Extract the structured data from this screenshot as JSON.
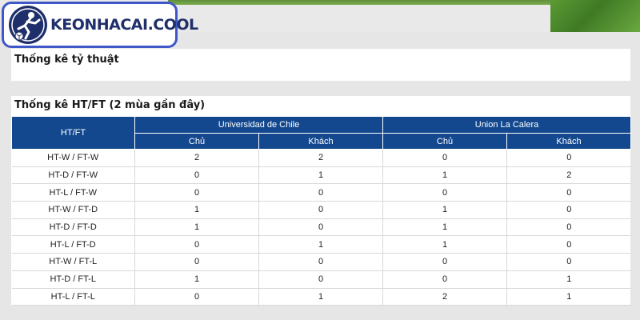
{
  "brand": {
    "name": "KEONHACAI.COOL"
  },
  "odds_panel": {
    "title": "Thống kê tỷ thuật"
  },
  "htft_panel": {
    "title": "Thống kê HT/FT (2 mùa gần đây)",
    "row_header": "HT/FT",
    "teams": [
      "Universidad de Chile",
      "Union La Calera"
    ],
    "sub_headers": [
      "Chủ",
      "Khách",
      "Chủ",
      "Khách"
    ],
    "rows": [
      {
        "label": "HT-W / FT-W",
        "values": [
          "2",
          "2",
          "0",
          "0"
        ]
      },
      {
        "label": "HT-D / FT-W",
        "values": [
          "0",
          "1",
          "1",
          "2"
        ]
      },
      {
        "label": "HT-L / FT-W",
        "values": [
          "0",
          "0",
          "0",
          "0"
        ]
      },
      {
        "label": "HT-W / FT-D",
        "values": [
          "1",
          "0",
          "1",
          "0"
        ]
      },
      {
        "label": "HT-D / FT-D",
        "values": [
          "1",
          "0",
          "1",
          "0"
        ]
      },
      {
        "label": "HT-L / FT-D",
        "values": [
          "0",
          "1",
          "1",
          "0"
        ]
      },
      {
        "label": "HT-W / FT-L",
        "values": [
          "0",
          "0",
          "0",
          "0"
        ]
      },
      {
        "label": "HT-D / FT-L",
        "values": [
          "1",
          "0",
          "0",
          "1"
        ]
      },
      {
        "label": "HT-L / FT-L",
        "values": [
          "0",
          "1",
          "2",
          "1"
        ]
      }
    ]
  },
  "colors": {
    "header_blue": "#13488f",
    "logo_border": "#3f57c9",
    "logo_text": "#1f2f6b"
  }
}
